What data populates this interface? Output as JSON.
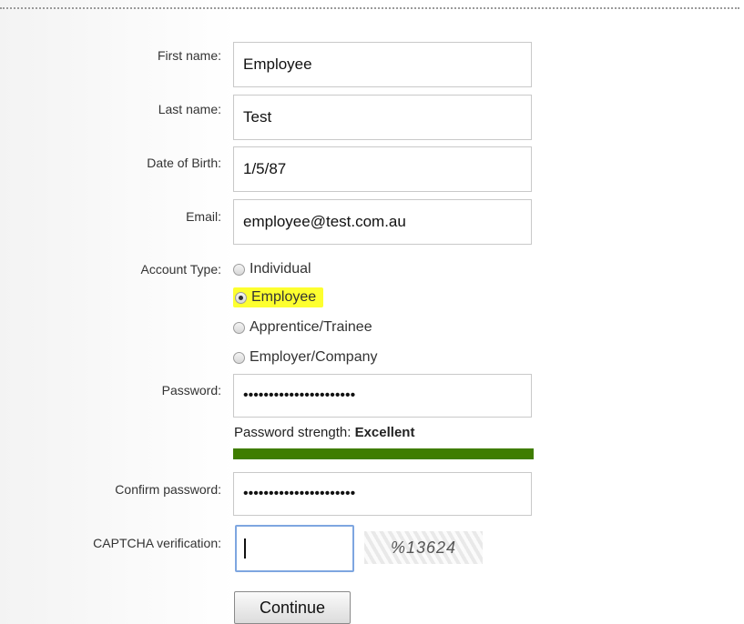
{
  "form": {
    "first_name": {
      "label": "First name:",
      "value": "Employee"
    },
    "last_name": {
      "label": "Last name:",
      "value": "Test"
    },
    "dob": {
      "label": "Date of Birth:",
      "value": "1/5/87"
    },
    "email": {
      "label": "Email:",
      "value": "employee@test.com.au"
    },
    "account_type": {
      "label": "Account Type:",
      "options": [
        "Individual",
        "Employee",
        "Apprentice/Trainee",
        "Employer/Company"
      ],
      "selected": "Employee"
    },
    "password": {
      "label": "Password:",
      "masked": "••••••••••••••••••••••"
    },
    "strength": {
      "prefix": "Password strength:",
      "value": "Excellent",
      "level": 1.0,
      "color": "#3f7d00"
    },
    "confirm_password": {
      "label": "Confirm password:",
      "masked": "••••••••••••••••••••••"
    },
    "captcha": {
      "label": "CAPTCHA verification:",
      "value": "",
      "image_text": "%13624"
    },
    "continue_label": "Continue"
  },
  "colors": {
    "highlight": "#fdff2f",
    "focus_border": "#7ea6e0"
  }
}
